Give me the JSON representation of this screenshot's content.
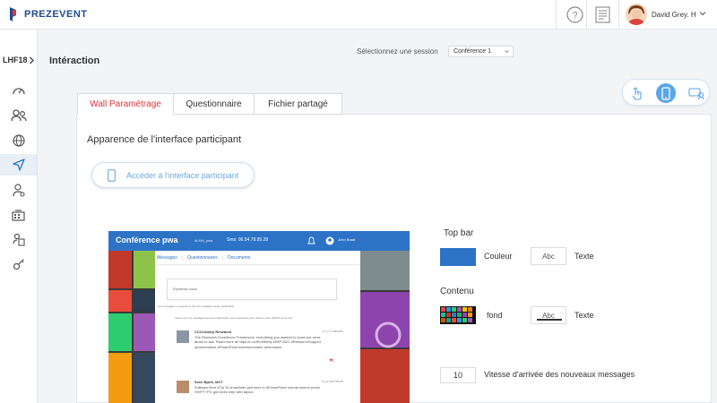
{
  "app": {
    "logo_text": "PREZEVENT"
  },
  "header": {
    "user_name": "David Grey. H"
  },
  "sidebar": {
    "event_code": "LHF18",
    "items": [
      {
        "icon": "dashboard-icon"
      },
      {
        "icon": "users-icon"
      },
      {
        "icon": "globe-icon"
      },
      {
        "icon": "send-icon",
        "active": true
      },
      {
        "icon": "user-settings-icon"
      },
      {
        "icon": "building-icon"
      },
      {
        "icon": "badge-icon"
      },
      {
        "icon": "key-icon"
      }
    ]
  },
  "page": {
    "title": "Intéraction",
    "session_label": "Sélectionnez une session",
    "session_value": "Conférence 1"
  },
  "tabs": [
    {
      "label": "Wall Paramétrage",
      "active": true
    },
    {
      "label": "Questionnaire",
      "active": false
    },
    {
      "label": "Fichier partagé",
      "active": false
    }
  ],
  "main": {
    "section_title": "Apparence de l'interface participant",
    "access_button": "Accéder à l'interface participant"
  },
  "preview": {
    "title": "Conférence pwa",
    "hashtag": "#LMH_pwa",
    "sms": "Sms: 06.54.78.95.28",
    "user": "John Bradt",
    "tabs": [
      "Messages",
      "Questionnaires",
      "Documents"
    ],
    "input_placeholder": "Exprimez-vous",
    "hint": "Les messages en questions font les mediateur avant publication",
    "vote_hint": "Votez pour les messages qui vous intéressent pour augmenter leur chance d'être affiché sur le mur",
    "posts": [
      {
        "author": "CCCLibrary Research",
        "time": "il y a 3 minutes",
        "body": "The Research Excellence Framework: everything you wanted to know but were afraid to ask. Read more at https://t.co/lRc9dfWq #REF2021 #ResearchSupport #presentation #PowerPoint #webformulaire #education",
        "likes": "1"
      },
      {
        "author": "Sven Bjork, MCT",
        "time": "il y a une heure",
        "body": "SoftwareTech #Tip To show/hide grid lines in #PowerPoint normal screen press SHIFT+F9, grid lines help with layout",
        "likes": ""
      }
    ]
  },
  "settings": {
    "top_bar_heading": "Top bar",
    "color_label": "Couleur",
    "text_label": "Texte",
    "text_sample": "Abc",
    "content_heading": "Contenu",
    "background_label": "fond",
    "content_text_label": "Texte",
    "content_text_sample": "Abc",
    "speed_value": "10",
    "speed_label": "Vitesse d'arrivée des nouveaux messages",
    "top_bar_color": "#2c73c6"
  }
}
